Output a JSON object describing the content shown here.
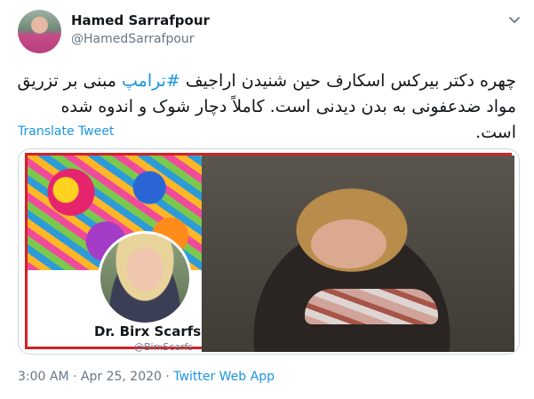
{
  "author": {
    "display_name": "Hamed Sarrafpour",
    "handle": "@HamedSarrafpour"
  },
  "tweet": {
    "text_before": "چهره دکتر بیرکس اسکارف حین شنیدن اراجیف ",
    "hashtag": "#ترامپ",
    "text_after": " مبنی بر تزریق مواد ضدعفونی به بدن دیدنی است. کاملاً دچار شوک و اندوه شده است.",
    "translate_label": "Translate Tweet"
  },
  "media": {
    "profile_name": "Dr. Birx Scarfs",
    "profile_handle": "@BirxScarfs",
    "frame_color": "#d61f26"
  },
  "meta": {
    "time": "3:00 AM",
    "separator": " · ",
    "date": "Apr 25, 2020",
    "app": "Twitter Web App"
  },
  "colors": {
    "link": "#1b95e0",
    "secondary_text": "#657786"
  },
  "icons": {
    "menu": "chevron-down-icon"
  }
}
